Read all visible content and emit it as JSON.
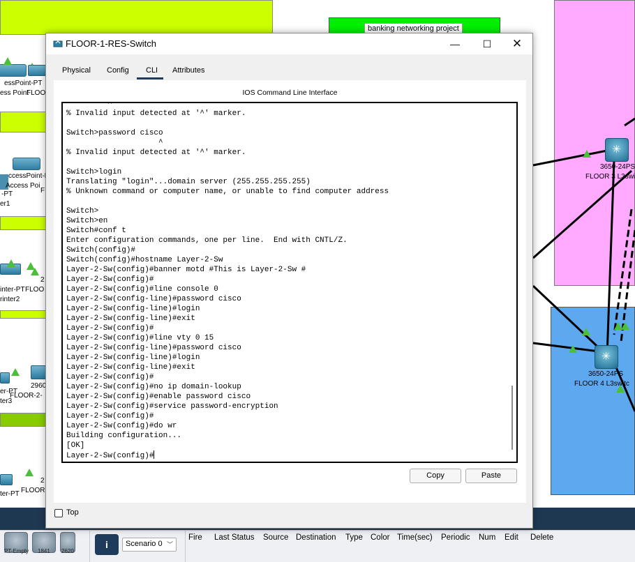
{
  "window": {
    "title": "FLOOR-1-RES-Switch",
    "tabs": [
      "Physical",
      "Config",
      "CLI",
      "Attributes"
    ],
    "active_tab": "CLI",
    "cli_heading": "IOS Command Line Interface",
    "terminal_lines": [
      "         ^",
      "% Invalid input detected at '^' marker.",
      "",
      "Switch>password cisco",
      "                    ^",
      "% Invalid input detected at '^' marker.",
      "",
      "Switch>login",
      "Translating \"login\"...domain server (255.255.255.255)",
      "% Unknown command or computer name, or unable to find computer address",
      "",
      "Switch>",
      "Switch>en",
      "Switch#conf t",
      "Enter configuration commands, one per line.  End with CNTL/Z.",
      "Switch(config)#",
      "Switch(config)#hostname Layer-2-Sw",
      "Layer-2-Sw(config)#banner motd #This is Layer-2-Sw #",
      "Layer-2-Sw(config)#",
      "Layer-2-Sw(config)#line console 0",
      "Layer-2-Sw(config-line)#password cisco",
      "Layer-2-Sw(config-line)#login",
      "Layer-2-Sw(config-line)#exit",
      "Layer-2-Sw(config)#",
      "Layer-2-Sw(config)#line vty 0 15",
      "Layer-2-Sw(config-line)#password cisco",
      "Layer-2-Sw(config-line)#login",
      "Layer-2-Sw(config-line)#exit",
      "Layer-2-Sw(config)#",
      "Layer-2-Sw(config)#no ip domain-lookup",
      "Layer-2-Sw(config)#enable password cisco",
      "Layer-2-Sw(config)#service password-encryption",
      "Layer-2-Sw(config)#",
      "Layer-2-Sw(config)#do wr",
      "Building configuration...",
      "[OK]",
      "Layer-2-Sw(config)#"
    ],
    "copy_label": "Copy",
    "paste_label": "Paste",
    "top_label": "Top",
    "top_checked": false
  },
  "workspace": {
    "note": "banking networking project",
    "labels": {
      "ap1_a": "essPoint-PT",
      "ap1_b": "ess Point",
      "ap1_c": "FLOO",
      "ap2_a": "ccessPoint-PT",
      "ap2_b": "Access Poi",
      "ap2_c": "F",
      "pr1_a": "-PT",
      "pr1_b": "er1",
      "pr2_a": "inter-PT",
      "pr2_b": "FLOO",
      "pr2_c": "rinter2",
      "pr2_d": "2",
      "pr3_a": "er-PT",
      "pr3_b": "2960",
      "pr3_c": "ter3",
      "pr3_d": "FLOOR-2-",
      "bot_a": "2",
      "bot_b": "ter-PT",
      "bot_c": "FLOOR",
      "f3_a": "3650-24PS",
      "f3_b": "FLOOR 3 L3swi",
      "f4_a": "3650-24PS",
      "f4_b": "FLOOR 4 L3switc"
    },
    "colors": {
      "lime": "#ccff00",
      "green": "#00ee00",
      "pink": "#ffaaff",
      "blue": "#5ea8f0"
    }
  },
  "bottom": {
    "devices": [
      "PT-Empty",
      "1841",
      "2620"
    ],
    "info_label": "i",
    "scenario": "Scenario 0",
    "pdu_columns": [
      "Fire",
      "Last Status",
      "Source",
      "Destination",
      "Type",
      "Color",
      "Time(sec)",
      "Periodic",
      "Num",
      "Edit",
      "Delete"
    ]
  }
}
